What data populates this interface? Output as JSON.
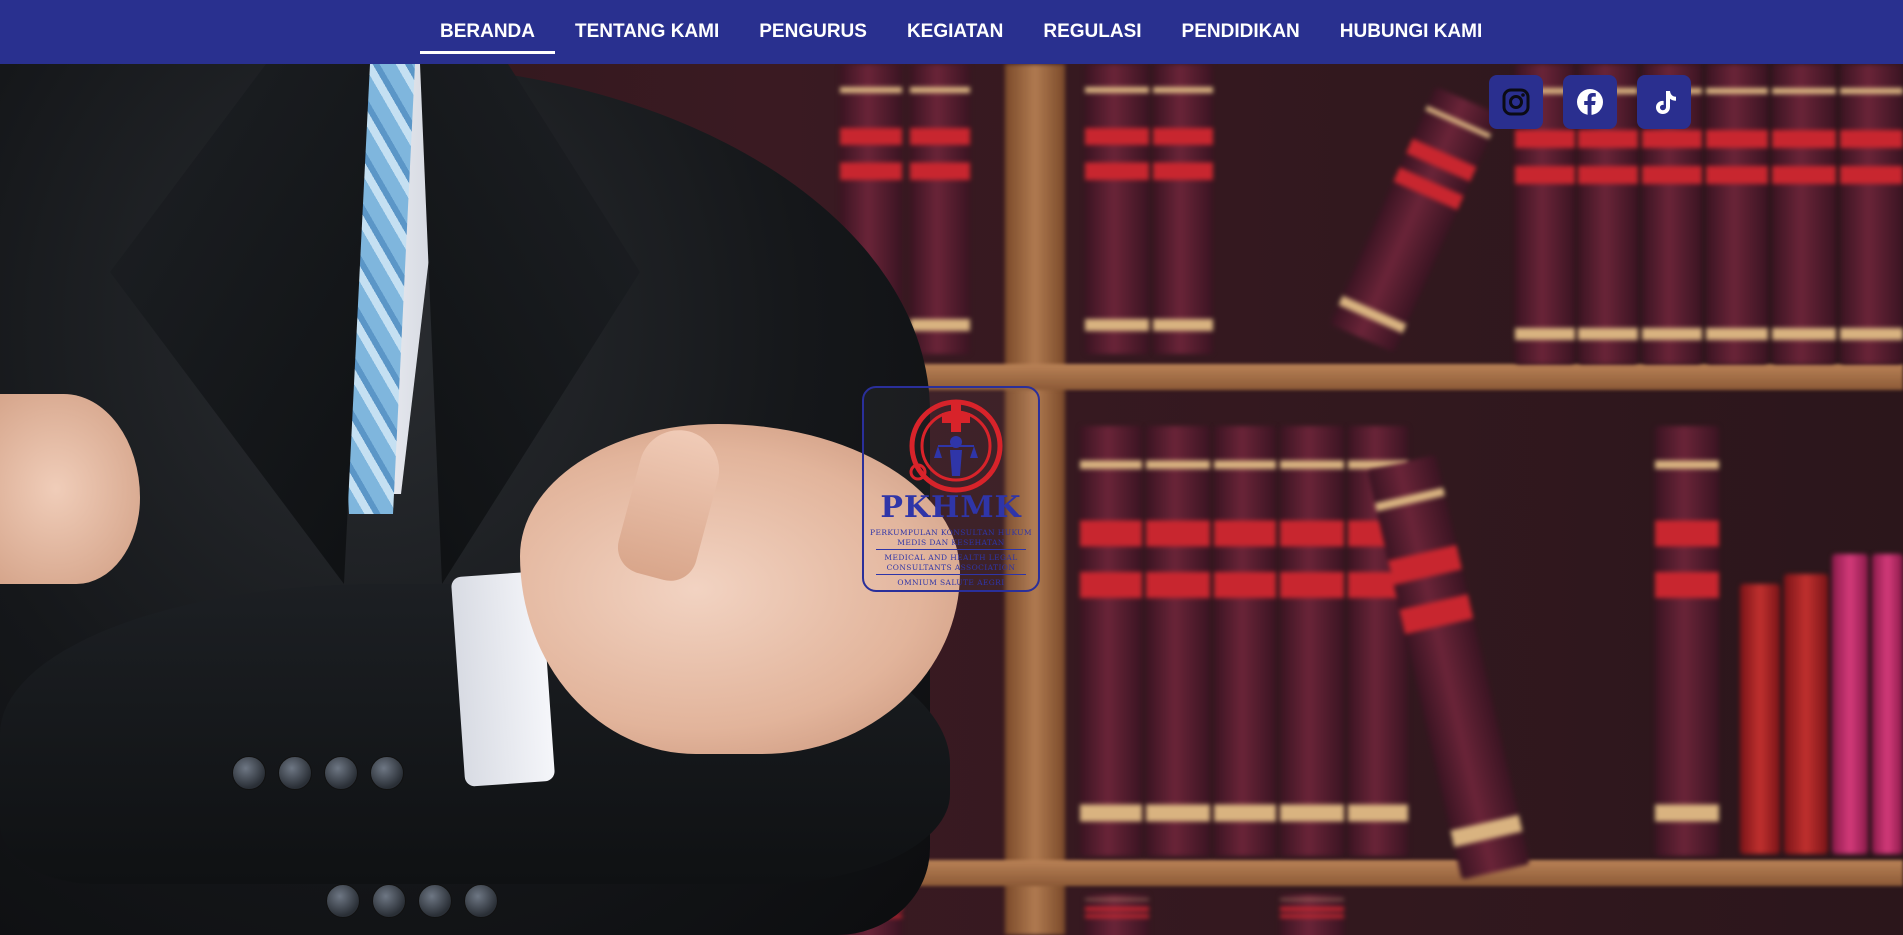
{
  "nav": {
    "items": [
      {
        "label": "BERANDA",
        "active": true
      },
      {
        "label": "TENTANG KAMI",
        "active": false
      },
      {
        "label": "PENGURUS",
        "active": false
      },
      {
        "label": "KEGIATAN",
        "active": false
      },
      {
        "label": "REGULASI",
        "active": false
      },
      {
        "label": "PENDIDIKAN",
        "active": false
      },
      {
        "label": "HUBUNGI KAMI",
        "active": false
      }
    ]
  },
  "social": [
    {
      "icon": "instagram-icon"
    },
    {
      "icon": "facebook-icon"
    },
    {
      "icon": "tiktok-icon"
    }
  ],
  "logo": {
    "title": "PKHMK",
    "line1": "PERKUMPULAN KONSULTAN HUKUM",
    "line2": "MEDIS DAN KESEHATAN",
    "line3": "MEDICAL AND HEALTH LEGAL",
    "line4": "CONSULTANTS ASSOCIATION",
    "motto": "OMNIUM SALUTE AEGRI"
  },
  "colors": {
    "nav_bg": "#29308f",
    "social_bg": "#2a2f8f",
    "logo_blue": "#2f35a8",
    "logo_red": "#d8232a"
  }
}
